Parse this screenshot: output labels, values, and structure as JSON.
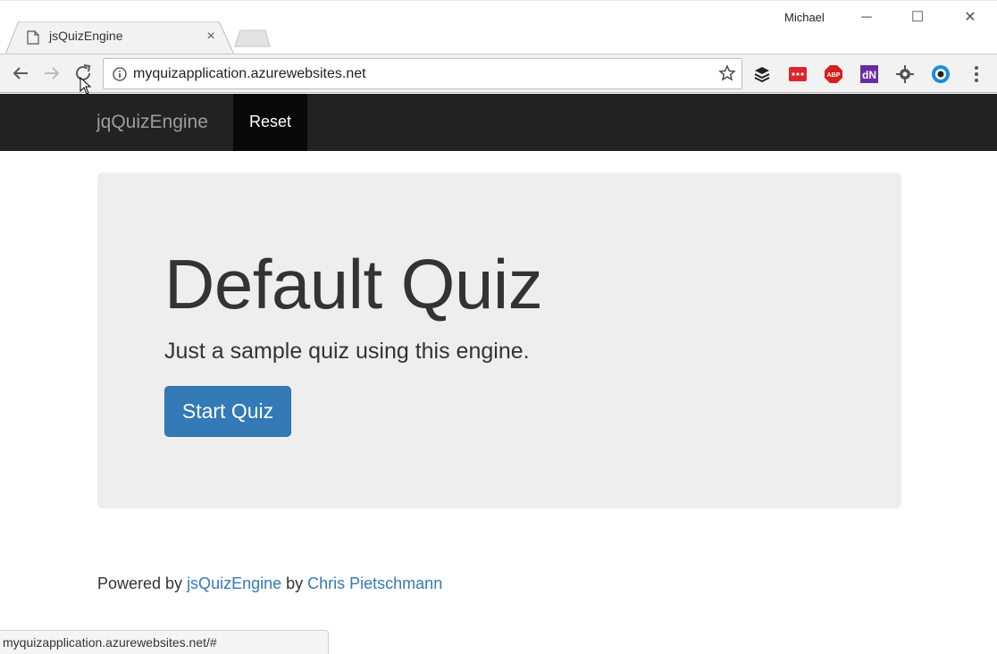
{
  "browser": {
    "tab_title": "jsQuizEngine",
    "tab_close": "×",
    "profile_name": "Michael",
    "window_minimize": "─",
    "window_maximize": "☐",
    "window_close": "✕",
    "url": "myquizapplication.azurewebsites.net",
    "status_url": "myquizapplication.azurewebsites.net/#",
    "extensions": [
      "layers-icon",
      "pocket-icon",
      "adblock-icon",
      "dn-icon",
      "gear-extension-icon",
      "globe-icon"
    ],
    "ext_labels": {
      "adblock": "ABP",
      "dn": "dN"
    }
  },
  "navbar": {
    "brand": "jqQuizEngine",
    "reset_label": "Reset"
  },
  "jumbotron": {
    "title": "Default Quiz",
    "subtitle": "Just a sample quiz using this engine.",
    "start_button": "Start Quiz"
  },
  "footer": {
    "prefix": "Powered by ",
    "link1": "jsQuizEngine",
    "middle": " by ",
    "link2": "Chris Pietschmann"
  },
  "colors": {
    "navbar_bg": "#222222",
    "active_nav_bg": "#080808",
    "primary": "#337ab7",
    "jumbotron_bg": "#eeeeee"
  }
}
